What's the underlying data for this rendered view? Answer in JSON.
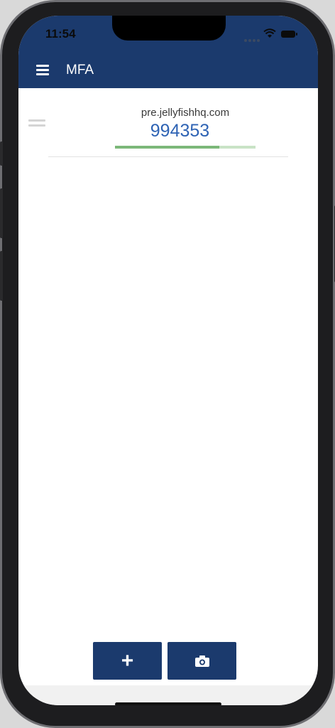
{
  "status_bar": {
    "time": "11:54"
  },
  "header": {
    "title": "MFA",
    "menu_icon": "hamburger-menu-icon"
  },
  "accounts": [
    {
      "issuer": "pre.jellyfishhq.com",
      "code": "994353",
      "time_remaining_fraction": 0.74
    }
  ],
  "actions": {
    "add_icon": "plus-icon",
    "scan_icon": "camera-icon"
  },
  "colors": {
    "primary": "#1b3a6d",
    "code": "#2e63b4",
    "progress_fill": "#7cb879",
    "progress_track": "#c9e3c6"
  }
}
